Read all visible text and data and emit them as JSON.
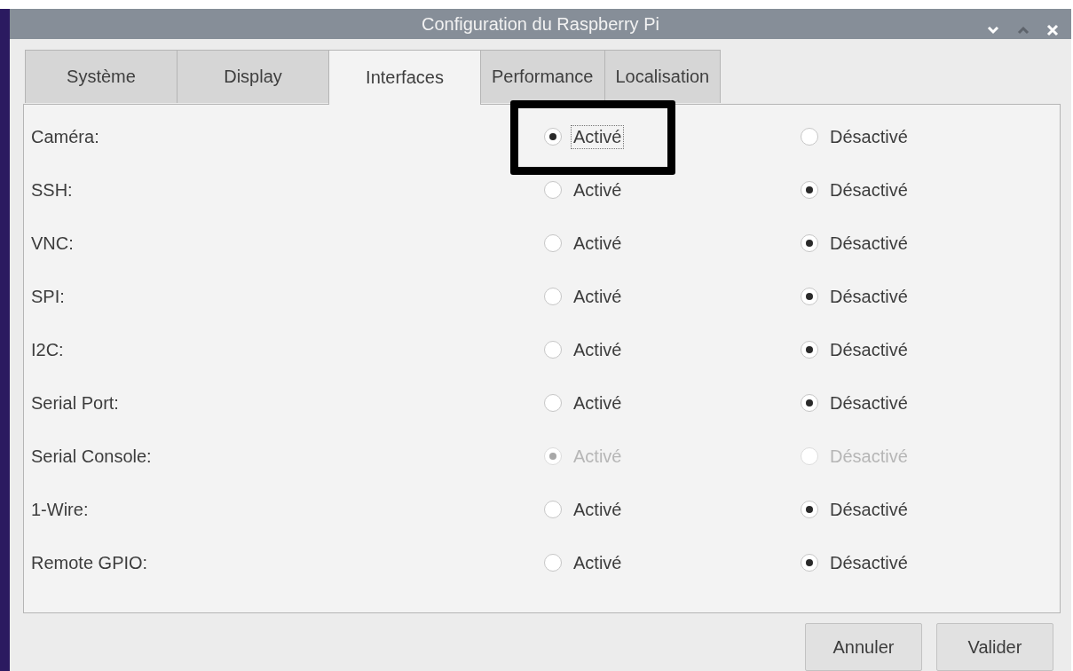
{
  "window": {
    "title": "Configuration du Raspberry Pi"
  },
  "tabs": [
    {
      "label": "Système",
      "selected": false
    },
    {
      "label": "Display",
      "selected": false
    },
    {
      "label": "Interfaces",
      "selected": true
    },
    {
      "label": "Performance",
      "selected": false
    },
    {
      "label": "Localisation",
      "selected": false
    }
  ],
  "rows": [
    {
      "label": "Caméra:",
      "disabled": false,
      "focused": true,
      "highlighted": true,
      "options": [
        {
          "label": "Activé",
          "selected": true
        },
        {
          "label": "Désactivé",
          "selected": false
        }
      ]
    },
    {
      "label": "SSH:",
      "disabled": false,
      "focused": false,
      "highlighted": false,
      "options": [
        {
          "label": "Activé",
          "selected": false
        },
        {
          "label": "Désactivé",
          "selected": true
        }
      ]
    },
    {
      "label": "VNC:",
      "disabled": false,
      "focused": false,
      "highlighted": false,
      "options": [
        {
          "label": "Activé",
          "selected": false
        },
        {
          "label": "Désactivé",
          "selected": true
        }
      ]
    },
    {
      "label": "SPI:",
      "disabled": false,
      "focused": false,
      "highlighted": false,
      "options": [
        {
          "label": "Activé",
          "selected": false
        },
        {
          "label": "Désactivé",
          "selected": true
        }
      ]
    },
    {
      "label": "I2C:",
      "disabled": false,
      "focused": false,
      "highlighted": false,
      "options": [
        {
          "label": "Activé",
          "selected": false
        },
        {
          "label": "Désactivé",
          "selected": true
        }
      ]
    },
    {
      "label": "Serial Port:",
      "disabled": false,
      "focused": false,
      "highlighted": false,
      "options": [
        {
          "label": "Activé",
          "selected": false
        },
        {
          "label": "Désactivé",
          "selected": true
        }
      ]
    },
    {
      "label": "Serial Console:",
      "disabled": true,
      "focused": false,
      "highlighted": false,
      "options": [
        {
          "label": "Activé",
          "selected": true
        },
        {
          "label": "Désactivé",
          "selected": false
        }
      ]
    },
    {
      "label": "1-Wire:",
      "disabled": false,
      "focused": false,
      "highlighted": false,
      "options": [
        {
          "label": "Activé",
          "selected": false
        },
        {
          "label": "Désactivé",
          "selected": true
        }
      ]
    },
    {
      "label": "Remote GPIO:",
      "disabled": false,
      "focused": false,
      "highlighted": false,
      "options": [
        {
          "label": "Activé",
          "selected": false
        },
        {
          "label": "Désactivé",
          "selected": true
        }
      ]
    }
  ],
  "buttons": [
    "Annuler",
    "Valider"
  ]
}
